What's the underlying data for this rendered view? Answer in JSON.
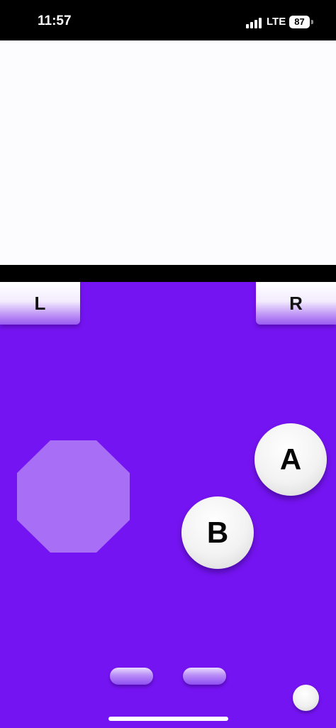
{
  "status_bar": {
    "time": "11:57",
    "network": "LTE",
    "battery": "87",
    "signal_icon": "signal-bars-icon",
    "battery_icon": "battery-icon"
  },
  "controller": {
    "l_label": "L",
    "r_label": "R",
    "a_label": "A",
    "b_label": "B",
    "dpad_icon": "octagon-dpad",
    "accent_color": "#7514f2"
  }
}
